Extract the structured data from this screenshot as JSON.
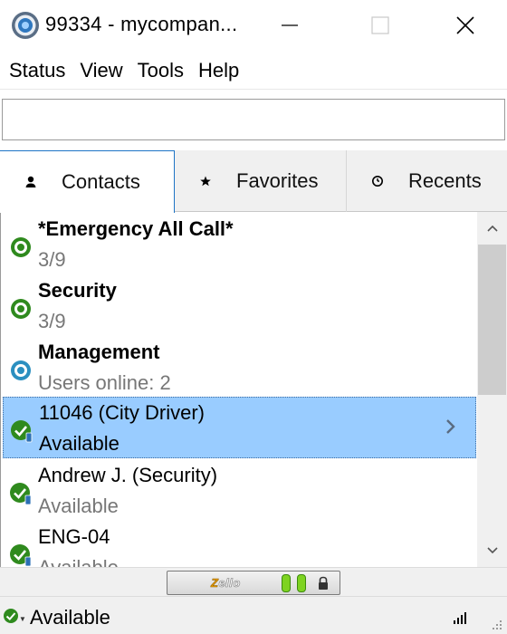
{
  "window": {
    "title": "99334 - mycompan...",
    "icon": "zello-app-icon",
    "controls": [
      "minimize-icon",
      "maximize-icon",
      "close-icon"
    ]
  },
  "menu": {
    "items": [
      {
        "label": "Status"
      },
      {
        "label": "View"
      },
      {
        "label": "Tools"
      },
      {
        "label": "Help"
      }
    ]
  },
  "search": {
    "value": "",
    "placeholder": ""
  },
  "tabs": [
    {
      "label": "Contacts",
      "icon": "person-icon",
      "active": true
    },
    {
      "label": "Favorites",
      "icon": "star-icon",
      "active": false
    },
    {
      "label": "Recents",
      "icon": "clock-icon",
      "active": false
    }
  ],
  "contacts": [
    {
      "name": "*Emergency All Call*",
      "sub": "3/9",
      "type": "channel-online",
      "bold": true
    },
    {
      "name": "Security",
      "sub": "3/9",
      "type": "channel-online",
      "bold": true
    },
    {
      "name": "Management",
      "sub": "Users online: 2",
      "type": "channel-blue",
      "bold": true
    },
    {
      "name": "11046 (City Driver)",
      "sub": "Available",
      "type": "user-available",
      "bold": false,
      "selected": true
    },
    {
      "name": "Andrew J. (Security)",
      "sub": "Available",
      "type": "user-available",
      "bold": false
    },
    {
      "name": "ENG-04",
      "sub": "Available",
      "type": "user-available",
      "bold": false
    }
  ],
  "ptt": {
    "logo_prefix": "Z",
    "logo_rest": "ello",
    "icon": "lock-icon"
  },
  "status_bar": {
    "status": "Available",
    "icon": "available-check-icon",
    "signal_icon": "signal-icon"
  },
  "colors": {
    "online_green": "#2f8a1e",
    "channel_blue": "#2b8fc0",
    "selection": "#99ccff",
    "tab_active_border": "#1e74c6",
    "led_green": "#7ed321"
  }
}
